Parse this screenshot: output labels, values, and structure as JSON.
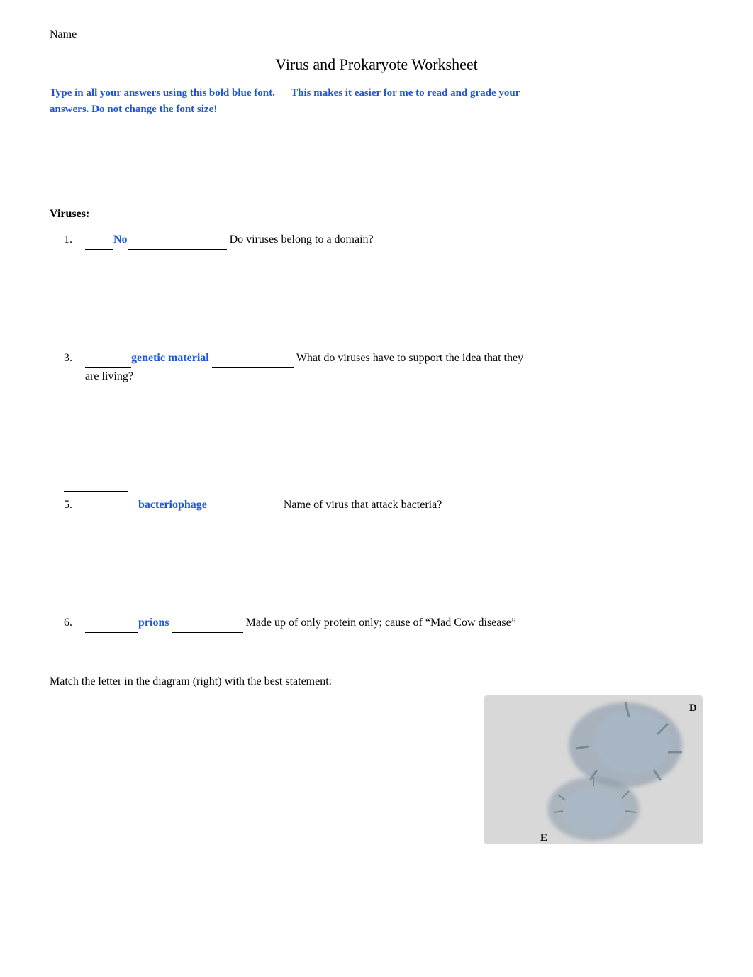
{
  "header": {
    "name_label": "Name",
    "title": "Virus and Prokaryote Worksheet"
  },
  "instructions": {
    "line1": "Type in all your answers using this bold blue font.",
    "line2": "This makes it easier for me to read and grade your",
    "line3": "answers.   Do not change the font size!"
  },
  "sections": {
    "viruses_header": "Viruses:",
    "questions": [
      {
        "number": "1.",
        "blank_before": "_____",
        "answer": "No",
        "blank_after": "_______________",
        "text": "Do viruses belong to a domain?"
      },
      {
        "number": "3.",
        "blank_before": "_________",
        "answer": "genetic material",
        "blank_mid": "_______________",
        "text": "What do viruses have to support the idea that they are living?"
      },
      {
        "number": "5.",
        "blank_before": "__________",
        "answer": "bacteriophage",
        "blank_mid": "_____________",
        "text": "Name of virus that attack bacteria?"
      },
      {
        "number": "6.",
        "blank_before": "__________",
        "answer": "prions",
        "blank_mid": "_____________",
        "text": "Made up of only protein only; cause of “Mad Cow disease”"
      }
    ],
    "match_header": "Match the letter in the diagram (right) with the best statement:",
    "diagram_labels": {
      "d": "D",
      "e": "E"
    }
  }
}
